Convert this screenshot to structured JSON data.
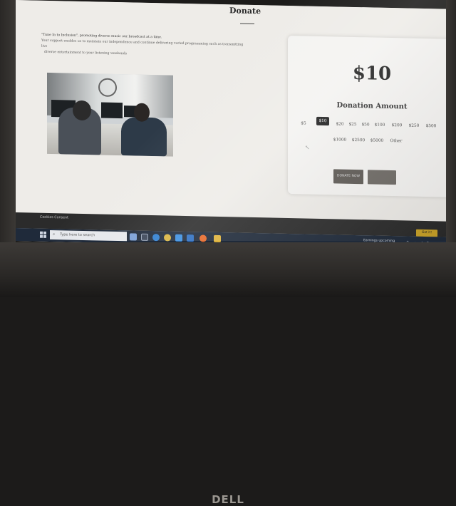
{
  "page": {
    "title": "Donate",
    "intro": {
      "line1": "\"Tune In to Inclusion\", promoting diverse music our broadcast at a time.",
      "line2": "Your support enables us to maintain our independence and continue delivering varied programming such as transmitting live",
      "line3": "diverse entertainment to your listening weekends"
    }
  },
  "donation": {
    "selected_amount": "$10",
    "label": "Donation Amount",
    "options_row1": [
      "$5",
      "$10",
      "$20",
      "$25",
      "$50",
      "$100",
      "$200",
      "$250",
      "$500"
    ],
    "options_row2": [
      "$1000",
      "$2500",
      "$5000",
      "Other"
    ],
    "selected_index": 1,
    "donate_button": "DONATE NOW",
    "accent_selected": "#1e1e1e"
  },
  "cookie": {
    "title": "Cookies Consent",
    "button": "Got it!",
    "button_color": "#c9a227"
  },
  "taskbar": {
    "search_placeholder": "Type here to search",
    "weather_text": "Earnings upcoming",
    "icons": [
      "start-icon",
      "search-icon",
      "widgets-icon",
      "task-view-icon",
      "edge-icon",
      "chrome-icon",
      "store-icon",
      "mail-icon",
      "firefox-icon",
      "file-explorer-icon"
    ]
  },
  "hardware": {
    "brand": "DELL"
  }
}
